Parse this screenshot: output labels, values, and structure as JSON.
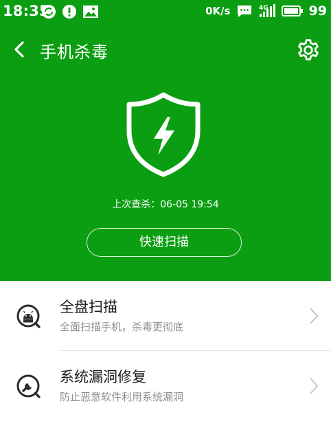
{
  "status_bar": {
    "time": "18:35",
    "net_speed": "0K/s",
    "battery": "99",
    "icons": [
      "sync-icon",
      "alert-icon",
      "image-icon",
      "message-icon",
      "4g-signal-icon",
      "battery-icon"
    ]
  },
  "header": {
    "title": "手机杀毒",
    "back_icon": "back-arrow-icon",
    "settings_icon": "gear-icon"
  },
  "hero": {
    "shield_icon": "shield-lightning-icon",
    "last_scan_label": "上次查杀：",
    "last_scan_time": "06-05 19:54",
    "quick_scan_label": "快速扫描"
  },
  "list": {
    "items": [
      {
        "title": "全盘扫描",
        "subtitle": "全面扫描手机，杀毒更彻底",
        "icon": "android-scan-icon"
      },
      {
        "title": "系统漏洞修复",
        "subtitle": "防止恶意软件利用系统漏洞",
        "icon": "wrench-icon"
      }
    ]
  },
  "colors": {
    "brand_green": "#0b9e12",
    "text_primary": "#1a1a1a",
    "text_secondary": "#8e8e8e"
  }
}
